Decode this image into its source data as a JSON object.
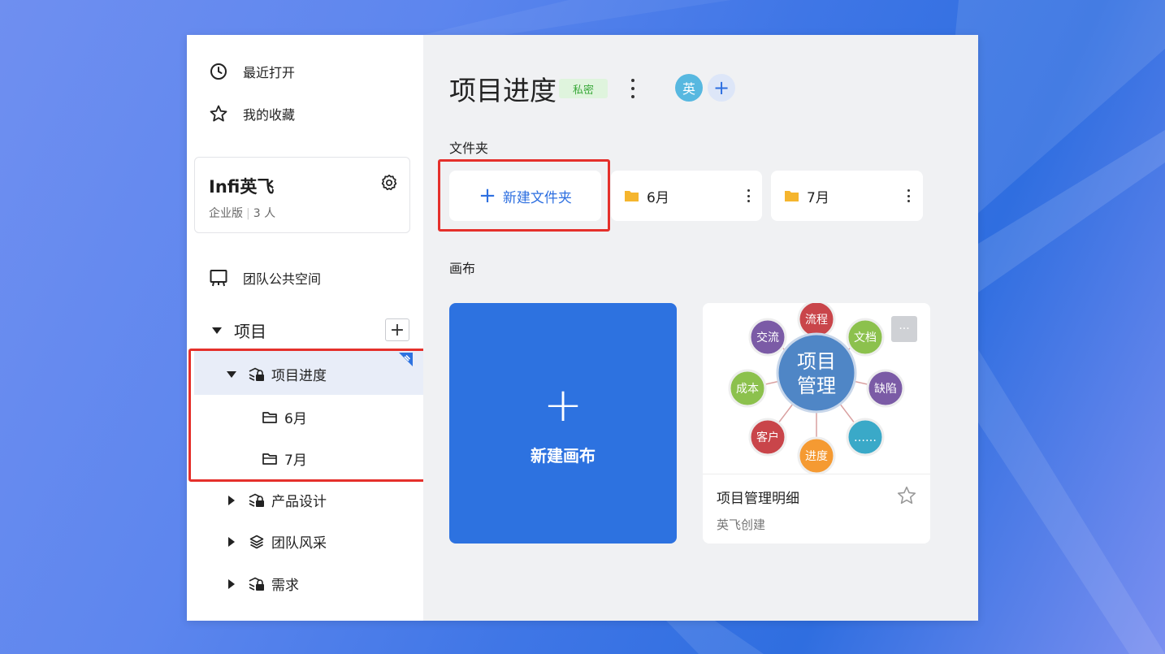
{
  "sidebar": {
    "recent_label": "最近打开",
    "favorites_label": "我的收藏",
    "workspace": {
      "name": "Infi英飞",
      "plan": "企业版",
      "members": "3 人"
    },
    "team_space_label": "团队公共空间",
    "section": {
      "label": "项目",
      "add_symbol": "+"
    },
    "tree": [
      {
        "label": "项目进度",
        "expanded": true,
        "selected": true,
        "children": [
          {
            "label": "6月"
          },
          {
            "label": "7月"
          }
        ]
      },
      {
        "label": "产品设计",
        "expanded": false
      },
      {
        "label": "团队风采",
        "expanded": false
      },
      {
        "label": "需求",
        "expanded": false
      }
    ]
  },
  "main": {
    "title": "项目进度",
    "badge": "私密",
    "avatar_text": "英",
    "add_member_symbol": "+",
    "folders_label": "文件夹",
    "new_folder_label": "新建文件夹",
    "new_folder_symbol": "+",
    "folders": [
      {
        "label": "6月"
      },
      {
        "label": "7月"
      }
    ],
    "canvas_label": "画布",
    "new_canvas": {
      "symbol": "+",
      "label": "新建画布"
    },
    "canvas_card": {
      "title": "项目管理明细",
      "creator": "英飞创建",
      "more": "···",
      "diagram": {
        "center": [
          "项目",
          "管理"
        ],
        "nodes": [
          "流程",
          "文档",
          "缺陷",
          "……",
          "进度",
          "客户",
          "成本",
          "交流"
        ]
      }
    }
  },
  "colors": {
    "accent": "#2d72e0",
    "highlight_red": "#e5302b",
    "badge_green": "#3aa83a",
    "folder_yellow": "#f5b52e",
    "node_colors": [
      "#c9454a",
      "#8cc14d",
      "#7b5ba6",
      "#3aa9c8",
      "#f59a32",
      "#c9454a",
      "#8cc14d",
      "#7b5ba6"
    ]
  }
}
